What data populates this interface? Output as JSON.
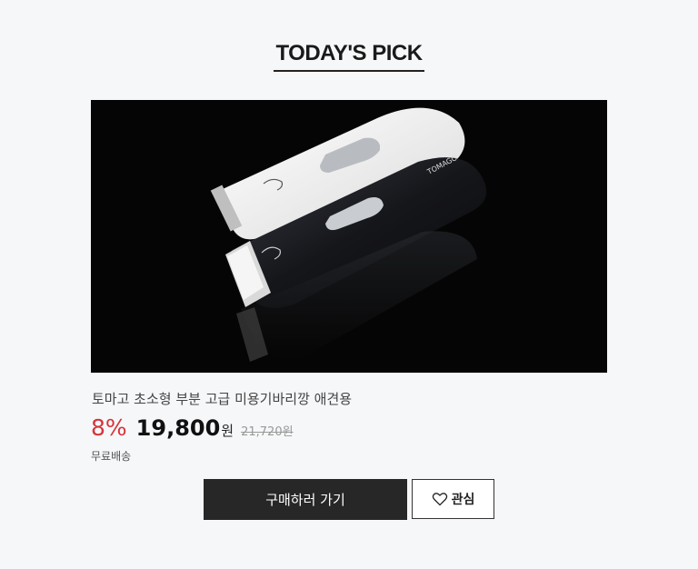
{
  "section": {
    "title": "TODAY'S PICK"
  },
  "product": {
    "name": "토마고 초소형 부분 고급 미용기바리깡 애견용",
    "discount": "8%",
    "price": "19,800",
    "price_unit": "원",
    "original_price": "21,720원",
    "shipping": "무료배송",
    "image_alt": "product-image"
  },
  "actions": {
    "buy_label": "구매하러 가기",
    "like_label": "관심"
  },
  "colors": {
    "discount": "#d6333a",
    "buy_button_bg": "#272727",
    "background": "#f6f7f9"
  }
}
